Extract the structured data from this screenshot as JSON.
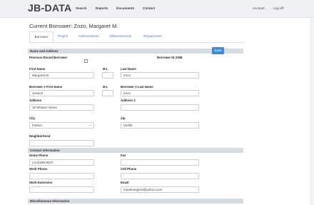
{
  "header": {
    "logo": "JB-DATA",
    "nav": [
      "Search",
      "Reports",
      "Documents",
      "Contact"
    ],
    "account": "Account",
    "logoff": "Log off"
  },
  "page": {
    "title": "Current Borrower: Zozo, Margaret M."
  },
  "tabs": [
    "Borrower",
    "Project",
    "Authorizations",
    "Disbursements",
    "Repayments"
  ],
  "sections": {
    "name_address": "Name and Address",
    "contact": "Contact Information",
    "misc": "Miscellaneous Information"
  },
  "save_label": "Save",
  "form": {
    "previous_round_label": "Previous Round Borrower",
    "borrower_id_label": "Borrower ID 2368",
    "first_name_label": "First Name",
    "first_name": "Margaret M.",
    "mi_label": "M.I.",
    "mi": "",
    "last_name_label": "Last Name",
    "last_name": "Zozo",
    "b2_first_label": "Borrower 2 First Name",
    "b2_first": "Jessica",
    "mi2_label": "M.I.",
    "mi2": "",
    "b2_last_label": "Borrower 2 Last Name",
    "b2_last": "Zozo",
    "address_label": "Address",
    "address": "18 Whalen Street",
    "address2_label": "Address 2",
    "address2": "",
    "city_label": "City",
    "city": "Palmer",
    "zip_label": "Zip",
    "zip": "01069",
    "neighborhood_label": "Neighborhood",
    "neighborhood": "",
    "home_phone_label": "Home Phone",
    "home_phone": "(413)289-9637",
    "fax_label": "Fax",
    "fax": "",
    "work_phone_label": "Work Phone",
    "work_phone": "",
    "cell_phone_label": "Cell Phone",
    "cell_phone": "",
    "work_ext_label": "Work Extension",
    "work_ext": "",
    "email_label": "Email",
    "email": "maalmargaret@yahoo.com"
  }
}
